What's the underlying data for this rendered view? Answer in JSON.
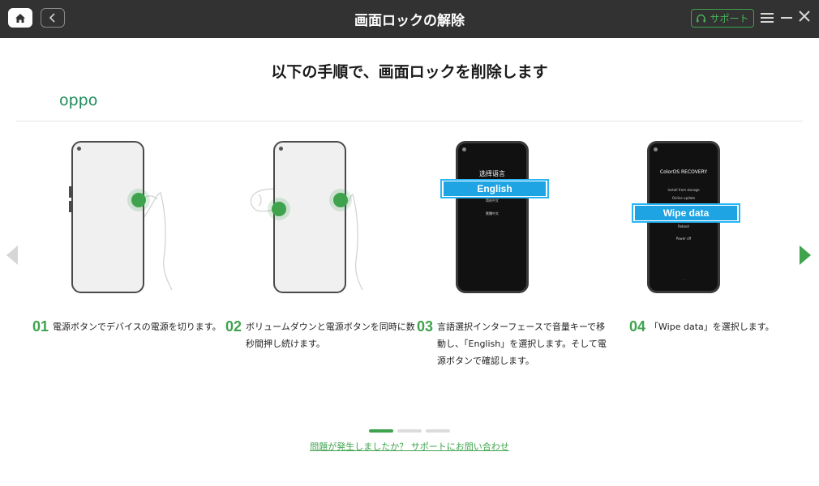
{
  "window": {
    "title": "画面ロックの解除",
    "support_label": "サポート"
  },
  "main": {
    "heading": "以下の手順で、画面ロックを削除します",
    "brand": "oppo"
  },
  "screens": {
    "s3": {
      "title": "选择语言",
      "highlight": "English",
      "item1": "简体中文",
      "item2": "繁體中文"
    },
    "s4": {
      "title": "ColorOS RECOVERY",
      "item1": "Install from storage",
      "item2": "Online update",
      "highlight": "Wipe data",
      "item3": "Reboot",
      "item4": "Power off",
      "footer": "..."
    }
  },
  "steps": [
    {
      "num": "01",
      "text": "電源ボタンでデバイスの電源を切ります。"
    },
    {
      "num": "02",
      "line1": "ボリュームダウンと電源ボタンを同時に数",
      "line2": "秒間押し続けます。"
    },
    {
      "num": "03",
      "line1": "言語選択インターフェースで音量キーで移",
      "line2": "動し、「English」を選択します。そして電",
      "line3": "源ボタンで確認します。"
    },
    {
      "num": "04",
      "text": "「Wipe data」を選択します。"
    }
  ],
  "pager": {
    "current": 1,
    "total": 3
  },
  "footer": {
    "help_link": "問題が発生しましたか？ サポートにお問い合わせ"
  },
  "colors": {
    "accent": "#3fa34d",
    "titlebar": "#323232",
    "highlight": "#1ea3e3"
  }
}
